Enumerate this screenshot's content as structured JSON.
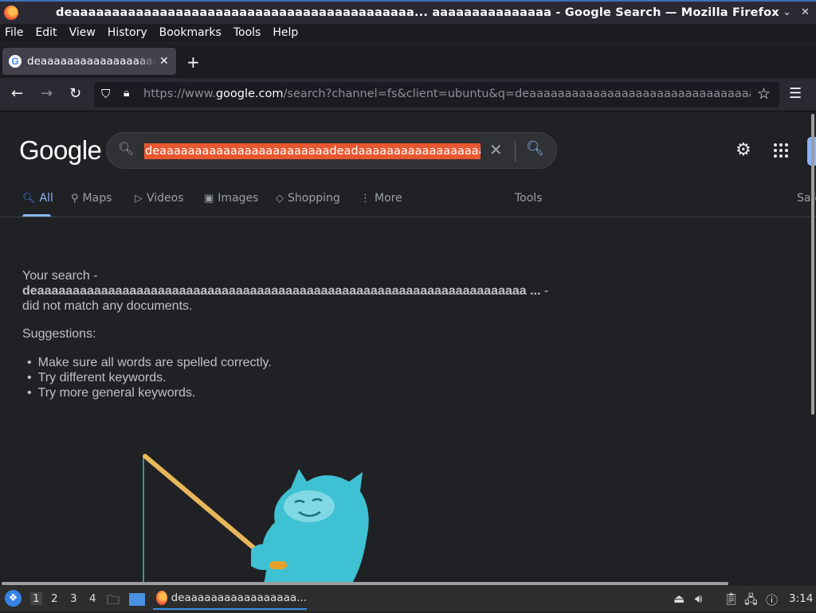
{
  "window": {
    "title": "deaaaaaaaaaaaaaaaaaaaaaaaaaaaaaaaaaaaaaaaaaaa... aaaaaaaaaaaaaaa - Google Search — Mozilla Firefox"
  },
  "menubar": [
    "File",
    "Edit",
    "View",
    "History",
    "Bookmarks",
    "Tools",
    "Help"
  ],
  "tab": {
    "title": "deaaaaaaaaaaaaaaaaaaaaaaaaaa"
  },
  "url": {
    "prefix": "https://www.",
    "domain": "google.com",
    "rest": "/search?channel=fs&client=ubuntu&q=deaaaaaaaaaaaaaaaaaaaaaaaaaaaaaaaaaaaaaaa"
  },
  "google": {
    "logo": "Google",
    "query": "deaaaaaaaaaaaaaaaaaaaaaaaadeadaaaaaaaaaaaaaaaaaaaaaa",
    "tabs": [
      {
        "label": "All",
        "icon": "search-icon",
        "active": true
      },
      {
        "label": "Maps",
        "icon": "pin-icon"
      },
      {
        "label": "Videos",
        "icon": "play-icon"
      },
      {
        "label": "Images",
        "icon": "image-icon"
      },
      {
        "label": "Shopping",
        "icon": "tag-icon"
      },
      {
        "label": "More",
        "icon": "more-vert-icon"
      }
    ],
    "tools": "Tools",
    "safe": "Safe",
    "noresult": {
      "prefix": "Your search -",
      "query": "deaaaaaaaaaaaaaaaaaaaaaaaaaaaaaaaaaaaaaaaaaaaaaaaaaaaaaaaaaaaaaaaaaaaaa ...",
      "suffix": "- did not match any documents."
    },
    "suggestions_title": "Suggestions:",
    "suggestions": [
      "Make sure all words are spelled correctly.",
      "Try different keywords.",
      "Try more general keywords."
    ]
  },
  "taskbar": {
    "workspaces": [
      "1",
      "2",
      "3",
      "4"
    ],
    "task_label": "deaaaaaaaaaaaaaaaaa...",
    "clock": "3:14"
  },
  "colors": {
    "page_bg": "#202124",
    "accent": "#8ab4f8",
    "query_highlight": "#e8572f"
  }
}
